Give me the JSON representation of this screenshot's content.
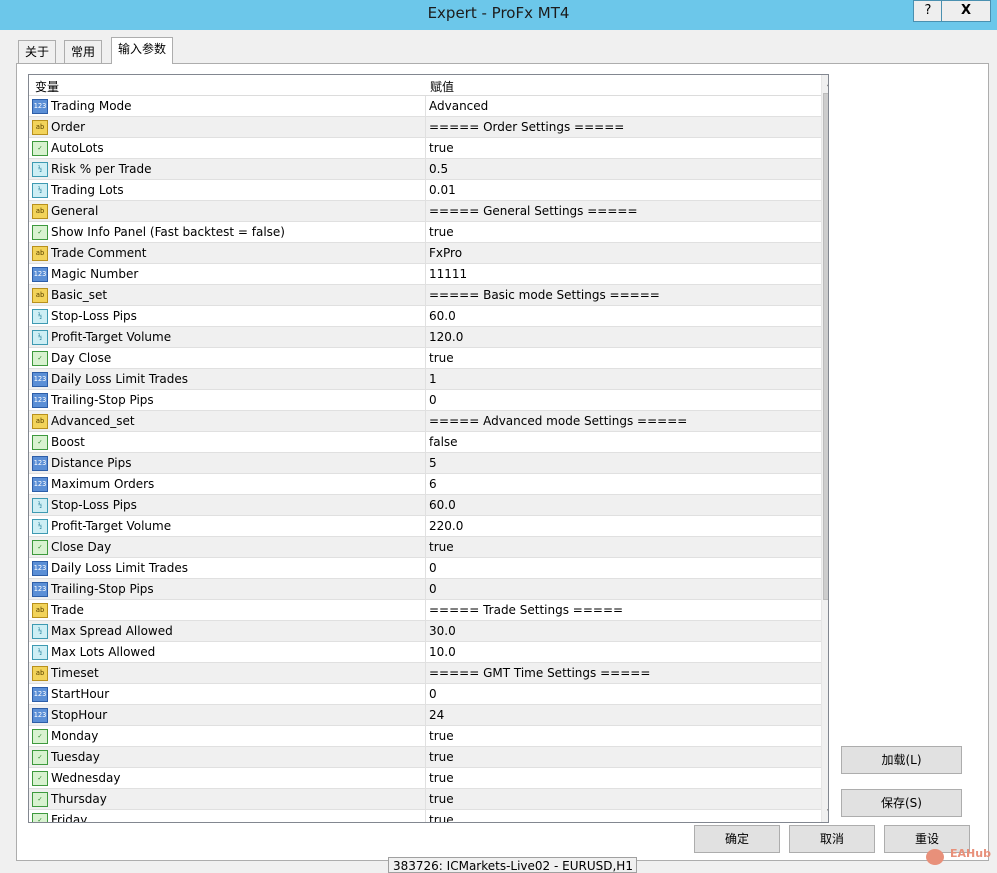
{
  "window": {
    "title": "Expert - ProFx MT4",
    "help_label": "?",
    "close_label": "X"
  },
  "tabs": [
    {
      "label": "关于"
    },
    {
      "label": "常用"
    },
    {
      "label": "输入参数",
      "active": true
    }
  ],
  "grid": {
    "col_variable": "变量",
    "col_value": "赋值",
    "rows": [
      {
        "type": "int",
        "name": "Trading Mode",
        "value": "Advanced"
      },
      {
        "type": "str",
        "name": "Order",
        "value": "===== Order Settings ====="
      },
      {
        "type": "bool",
        "name": "AutoLots",
        "value": "true"
      },
      {
        "type": "dbl",
        "name": "Risk % per Trade",
        "value": "0.5"
      },
      {
        "type": "dbl",
        "name": "Trading Lots",
        "value": "0.01"
      },
      {
        "type": "str",
        "name": "General",
        "value": "===== General Settings ====="
      },
      {
        "type": "bool",
        "name": "Show Info Panel (Fast backtest = false)",
        "value": "true"
      },
      {
        "type": "str",
        "name": "Trade Comment",
        "value": "FxPro"
      },
      {
        "type": "int",
        "name": "Magic Number",
        "value": "11111"
      },
      {
        "type": "str",
        "name": "Basic_set",
        "value": "===== Basic mode Settings ====="
      },
      {
        "type": "dbl",
        "name": "Stop-Loss Pips",
        "value": "60.0"
      },
      {
        "type": "dbl",
        "name": "Profit-Target Volume",
        "value": "120.0"
      },
      {
        "type": "bool",
        "name": "Day Close",
        "value": "true"
      },
      {
        "type": "int",
        "name": "Daily Loss Limit Trades",
        "value": "1"
      },
      {
        "type": "int",
        "name": "Trailing-Stop Pips",
        "value": "0"
      },
      {
        "type": "str",
        "name": "Advanced_set",
        "value": "===== Advanced mode Settings ====="
      },
      {
        "type": "bool",
        "name": "Boost",
        "value": "false"
      },
      {
        "type": "int",
        "name": "Distance Pips",
        "value": "5"
      },
      {
        "type": "int",
        "name": "Maximum Orders",
        "value": "6"
      },
      {
        "type": "dbl",
        "name": "Stop-Loss Pips",
        "value": "60.0"
      },
      {
        "type": "dbl",
        "name": "Profit-Target Volume",
        "value": "220.0"
      },
      {
        "type": "bool",
        "name": "Close Day",
        "value": "true"
      },
      {
        "type": "int",
        "name": "Daily Loss Limit Trades",
        "value": "0"
      },
      {
        "type": "int",
        "name": "Trailing-Stop Pips",
        "value": "0"
      },
      {
        "type": "str",
        "name": "Trade",
        "value": "===== Trade Settings ====="
      },
      {
        "type": "dbl",
        "name": "Max Spread Allowed",
        "value": "30.0"
      },
      {
        "type": "dbl",
        "name": "Max Lots Allowed",
        "value": "10.0"
      },
      {
        "type": "str",
        "name": "Timeset",
        "value": "===== GMT Time Settings ====="
      },
      {
        "type": "int",
        "name": "StartHour",
        "value": "0"
      },
      {
        "type": "int",
        "name": "StopHour",
        "value": "24"
      },
      {
        "type": "bool",
        "name": "Monday",
        "value": "true"
      },
      {
        "type": "bool",
        "name": "Tuesday",
        "value": "true"
      },
      {
        "type": "bool",
        "name": "Wednesday",
        "value": "true"
      },
      {
        "type": "bool",
        "name": "Thursday",
        "value": "true"
      },
      {
        "type": "bool",
        "name": "Friday",
        "value": "true"
      }
    ]
  },
  "icons": {
    "int": "123",
    "str": "ab",
    "bool": "✓",
    "dbl": "½"
  },
  "buttons": {
    "load": "加载(L)",
    "save": "保存(S)",
    "ok": "确定",
    "cancel": "取消",
    "reset": "重设"
  },
  "status": {
    "text": "383726: ICMarkets-Live02 - EURUSD,H1"
  },
  "watermark": "EAHub"
}
